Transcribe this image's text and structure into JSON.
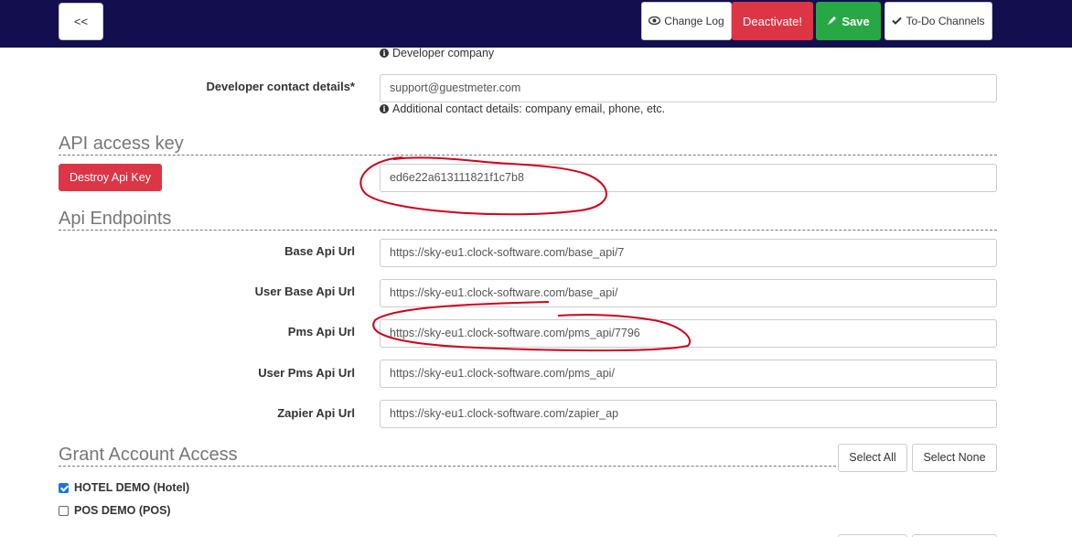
{
  "toolbar": {
    "back_label": "<<",
    "change_log_label": "Change Log",
    "deactivate_label": "Deactivate!",
    "save_label": "Save",
    "todo_label": "To-Do Channels"
  },
  "developer": {
    "company_help": "Developer company",
    "contact_label": "Developer contact details*",
    "contact_value": "support@guestmeter.com",
    "contact_help": "Additional contact details: company email, phone, etc."
  },
  "api_key": {
    "title": "API access key",
    "destroy_label": "Destroy Api Key",
    "value": "ed6e22a613111821f1c7b8"
  },
  "endpoints": {
    "title": "Api Endpoints",
    "items": [
      {
        "label": "Base Api Url",
        "value": "https://sky-eu1.clock-software.com/base_api/7"
      },
      {
        "label": "User Base Api Url",
        "value": "https://sky-eu1.clock-software.com/base_api/"
      },
      {
        "label": "Pms Api Url",
        "value": "https://sky-eu1.clock-software.com/pms_api/7796"
      },
      {
        "label": "User Pms Api Url",
        "value": "https://sky-eu1.clock-software.com/pms_api/"
      },
      {
        "label": "Zapier Api Url",
        "value": "https://sky-eu1.clock-software.com/zapier_ap"
      }
    ]
  },
  "grant": {
    "title": "Grant Account Access",
    "select_all_label": "Select All",
    "select_none_label": "Select None",
    "accounts": [
      {
        "label": "HOTEL DEMO (Hotel)",
        "checked": true
      },
      {
        "label": "POS DEMO (POS)",
        "checked": false
      }
    ]
  },
  "icons": {
    "change_log": "eye-icon",
    "save": "pencil-icon",
    "todo": "check-icon",
    "info": "info-circle-icon"
  },
  "colors": {
    "topbar": "#130f4f",
    "danger": "#dc3545",
    "success": "#28a745",
    "annotation": "#d0021b"
  }
}
